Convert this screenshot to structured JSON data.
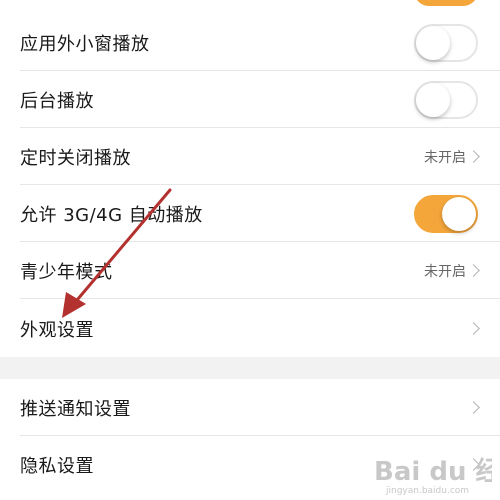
{
  "rows": [
    {
      "label": "应用外小窗播放",
      "control": "toggle",
      "on": false
    },
    {
      "label": "后台播放",
      "control": "toggle",
      "on": false
    },
    {
      "label": "定时关闭播放",
      "control": "value",
      "value": "未开启"
    },
    {
      "label": "允许 3G/4G 自动播放",
      "control": "toggle",
      "on": true
    },
    {
      "label": "青少年模式",
      "control": "value",
      "value": "未开启"
    },
    {
      "label": "外观设置",
      "control": "chevron"
    },
    {
      "label": "推送通知设置",
      "control": "chevron"
    },
    {
      "label": "隐私设置",
      "control": "chevron"
    }
  ],
  "colors": {
    "toggle_on": "#f4a63a",
    "arrow": "#b3312f",
    "section_gap": "#f2f2f2"
  },
  "watermark": {
    "text": "Bai du 经验",
    "sub": "jingyan.baidu.com"
  }
}
